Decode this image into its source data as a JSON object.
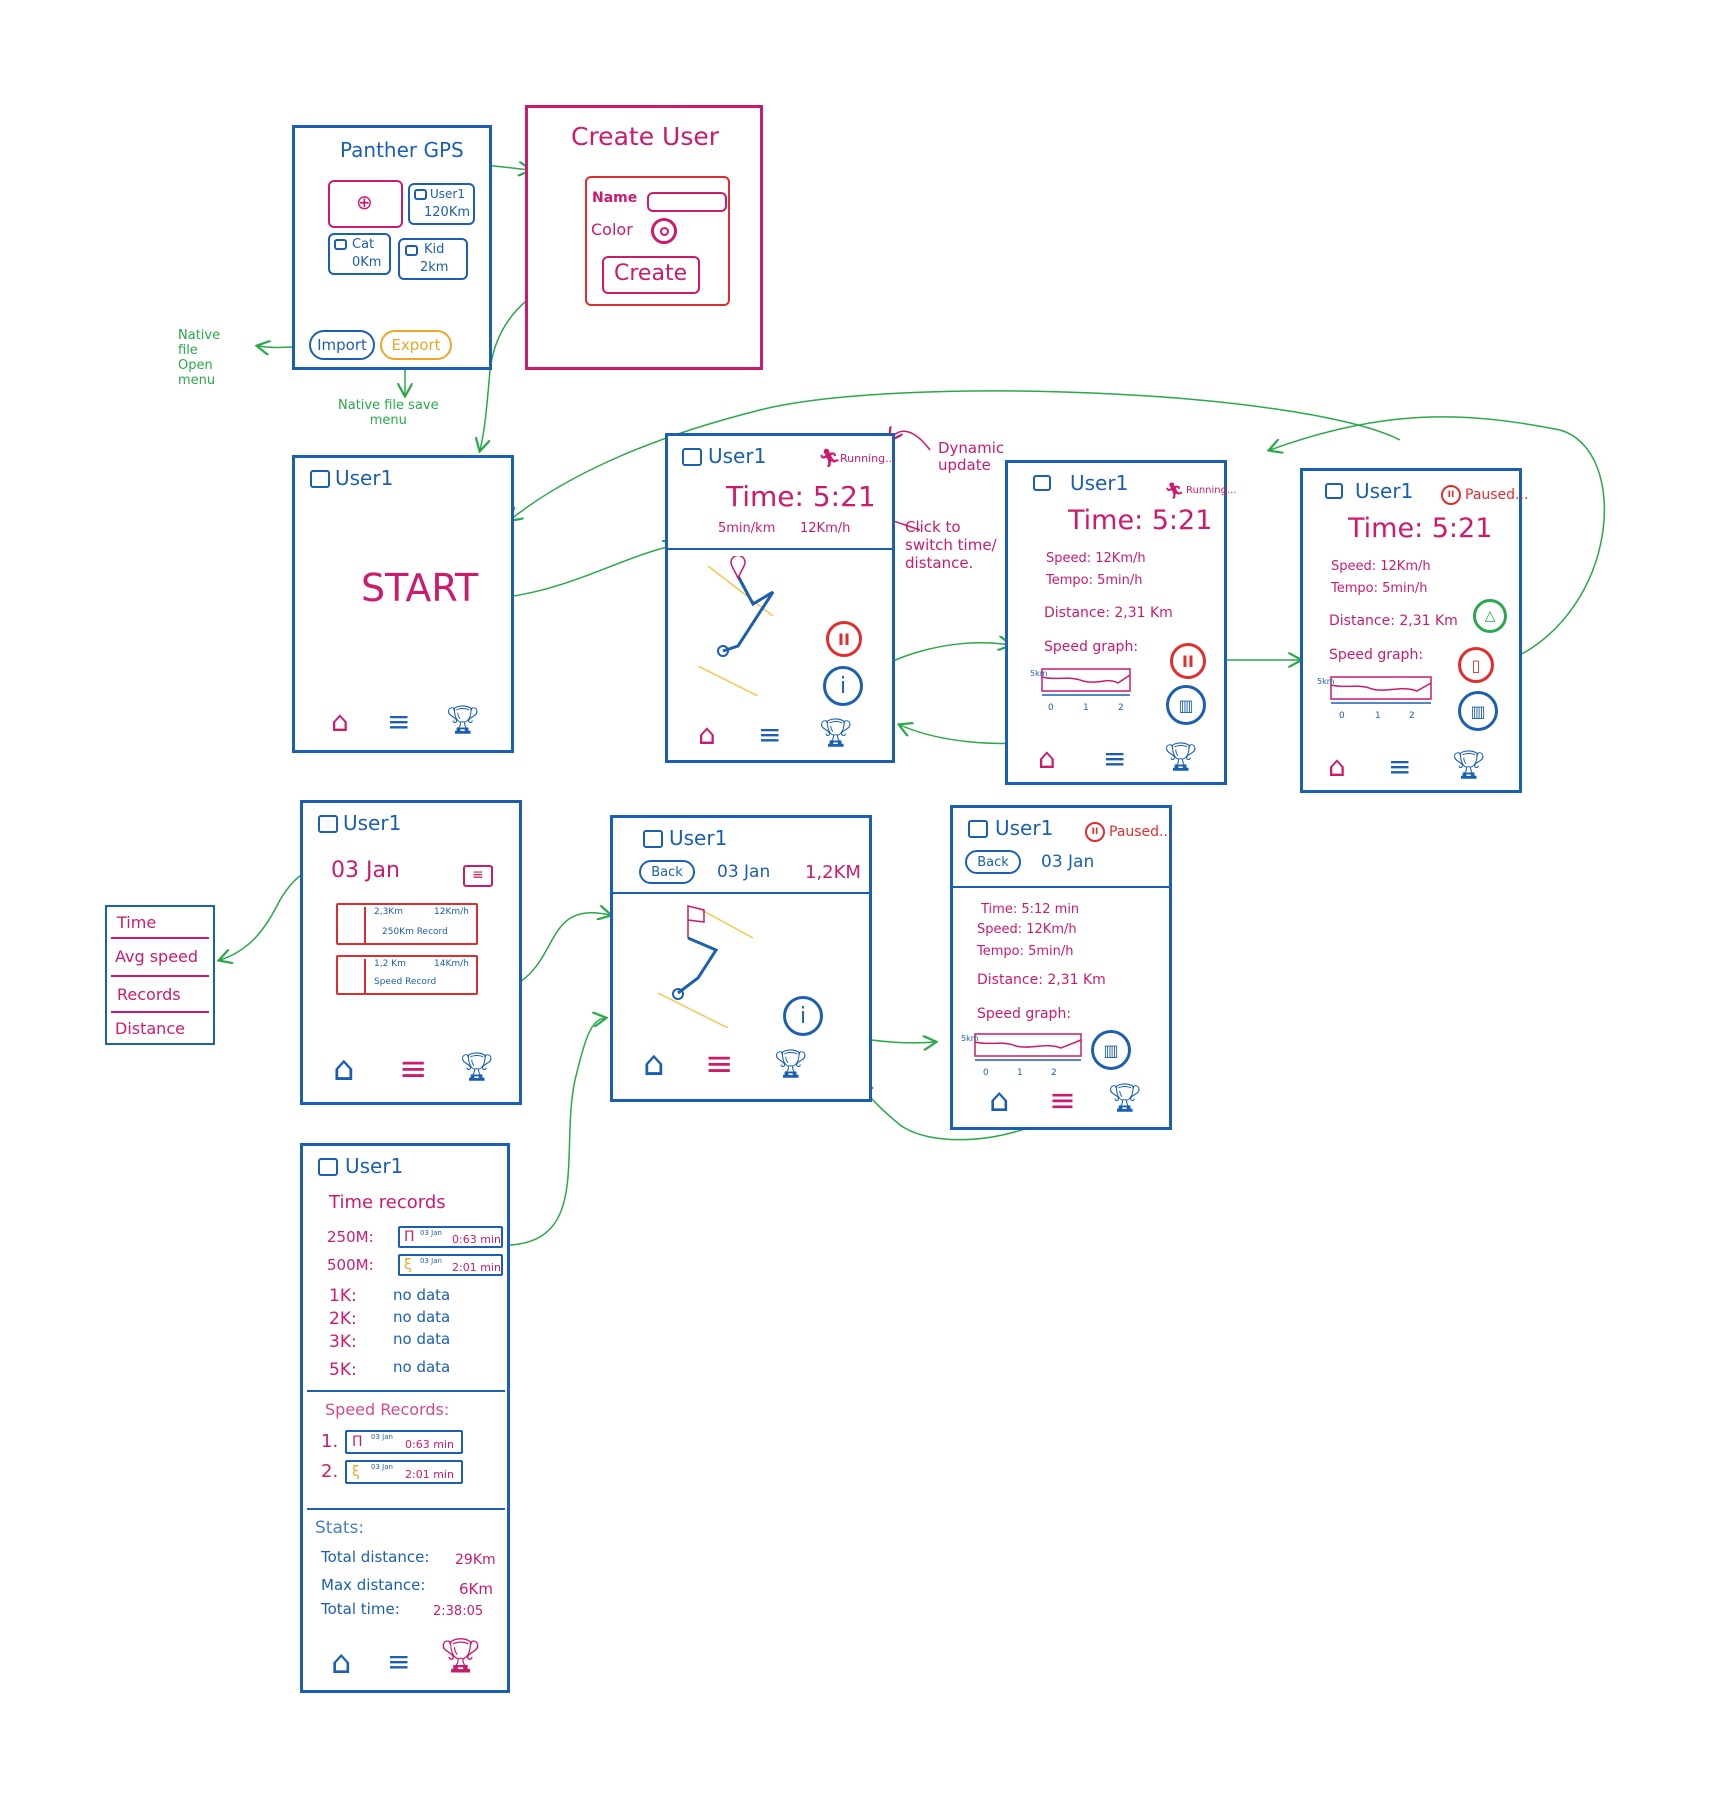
{
  "home": {
    "title": "Panther GPS",
    "add_tile_symbol": "⊕",
    "users": [
      {
        "name": "User1",
        "distance": "120Km"
      },
      {
        "name": "Cat",
        "distance": "0Km"
      },
      {
        "name": "Kid",
        "distance": "2km"
      }
    ],
    "import_label": "Import",
    "export_label": "Export"
  },
  "annotations": {
    "native_open": "Native\nfile\nOpen\nmenu",
    "native_save": "Native file save\nmenu",
    "dynamic_update": "Dynamic\nupdate",
    "click_switch": "Click to\nswitch time/\ndistance."
  },
  "create_user": {
    "title": "Create User",
    "name_label": "Name",
    "color_label": "Color",
    "create_button": "Create"
  },
  "user": "User1",
  "start_screen": {
    "start_label": "START"
  },
  "run_screen": {
    "status": "Running...",
    "time": "Time: 5:21",
    "pace": "5min/km",
    "speed": "12Km/h"
  },
  "details_running": {
    "status": "Running...",
    "time": "Time: 5:21",
    "speed_line": "Speed: 12Km/h",
    "tempo_line": "Tempo: 5min/h",
    "distance_line": "Distance: 2,31 Km",
    "graph_label": "Speed graph:"
  },
  "details_paused": {
    "status": "Paused...",
    "time": "Time: 5:21",
    "speed_line": "Speed: 12Km/h",
    "tempo_line": "Tempo: 5min/h",
    "distance_line": "Distance: 2,31 Km",
    "graph_label": "Speed graph:"
  },
  "graph": {
    "y_label": "5km",
    "ticks": [
      "0",
      "1",
      "2"
    ]
  },
  "history_screen": {
    "date": "03 Jan",
    "runs": [
      {
        "distance": "2,3Km",
        "speed": "12Km/h",
        "record": "250Km Record"
      },
      {
        "distance": "1,2 Km",
        "speed": "14Km/h",
        "record": "Speed Record"
      }
    ]
  },
  "sort_menu": [
    "Time",
    "Avg speed",
    "Records",
    "Distance"
  ],
  "history_detail": {
    "back_label": "Back",
    "date": "03 Jan",
    "distance": "1,2KM"
  },
  "history_stats": {
    "status": "Paused...",
    "back_label": "Back",
    "date": "03 Jan",
    "time_line": "Time: 5:12 min",
    "speed_line": "Speed: 12Km/h",
    "tempo_line": "Tempo: 5min/h",
    "distance_line": "Distance: 2,31 Km",
    "graph_label": "Speed graph:"
  },
  "records_screen": {
    "time_title": "Time records",
    "time_records": [
      {
        "label": "250M:",
        "date": "03 Jan",
        "value": "0:63 min"
      },
      {
        "label": "500M:",
        "date": "03 Jan",
        "value": "2:01 min"
      },
      {
        "label": "1K:",
        "value": "no data"
      },
      {
        "label": "2K:",
        "value": "no data"
      },
      {
        "label": "3K:",
        "value": "no data"
      },
      {
        "label": "5K:",
        "value": "no data"
      }
    ],
    "speed_title": "Speed Records:",
    "speed_records": [
      {
        "label": "1.",
        "date": "03 Jan",
        "value": "0:63 min"
      },
      {
        "label": "2.",
        "date": "03 Jan",
        "value": "2:01 min"
      }
    ],
    "stats_title": "Stats:",
    "stats": [
      {
        "label": "Total distance:",
        "value": "29Km"
      },
      {
        "label": "Max distance:",
        "value": "6Km"
      },
      {
        "label": "Total time:",
        "value": "2:38:05"
      }
    ]
  },
  "colors": {
    "blue": "#1b5fb3",
    "magenta": "#cc1a6e",
    "red": "#e02d2d",
    "green": "#2aa84a",
    "orange": "#f0a42a",
    "yellow": "#f2c84a"
  }
}
